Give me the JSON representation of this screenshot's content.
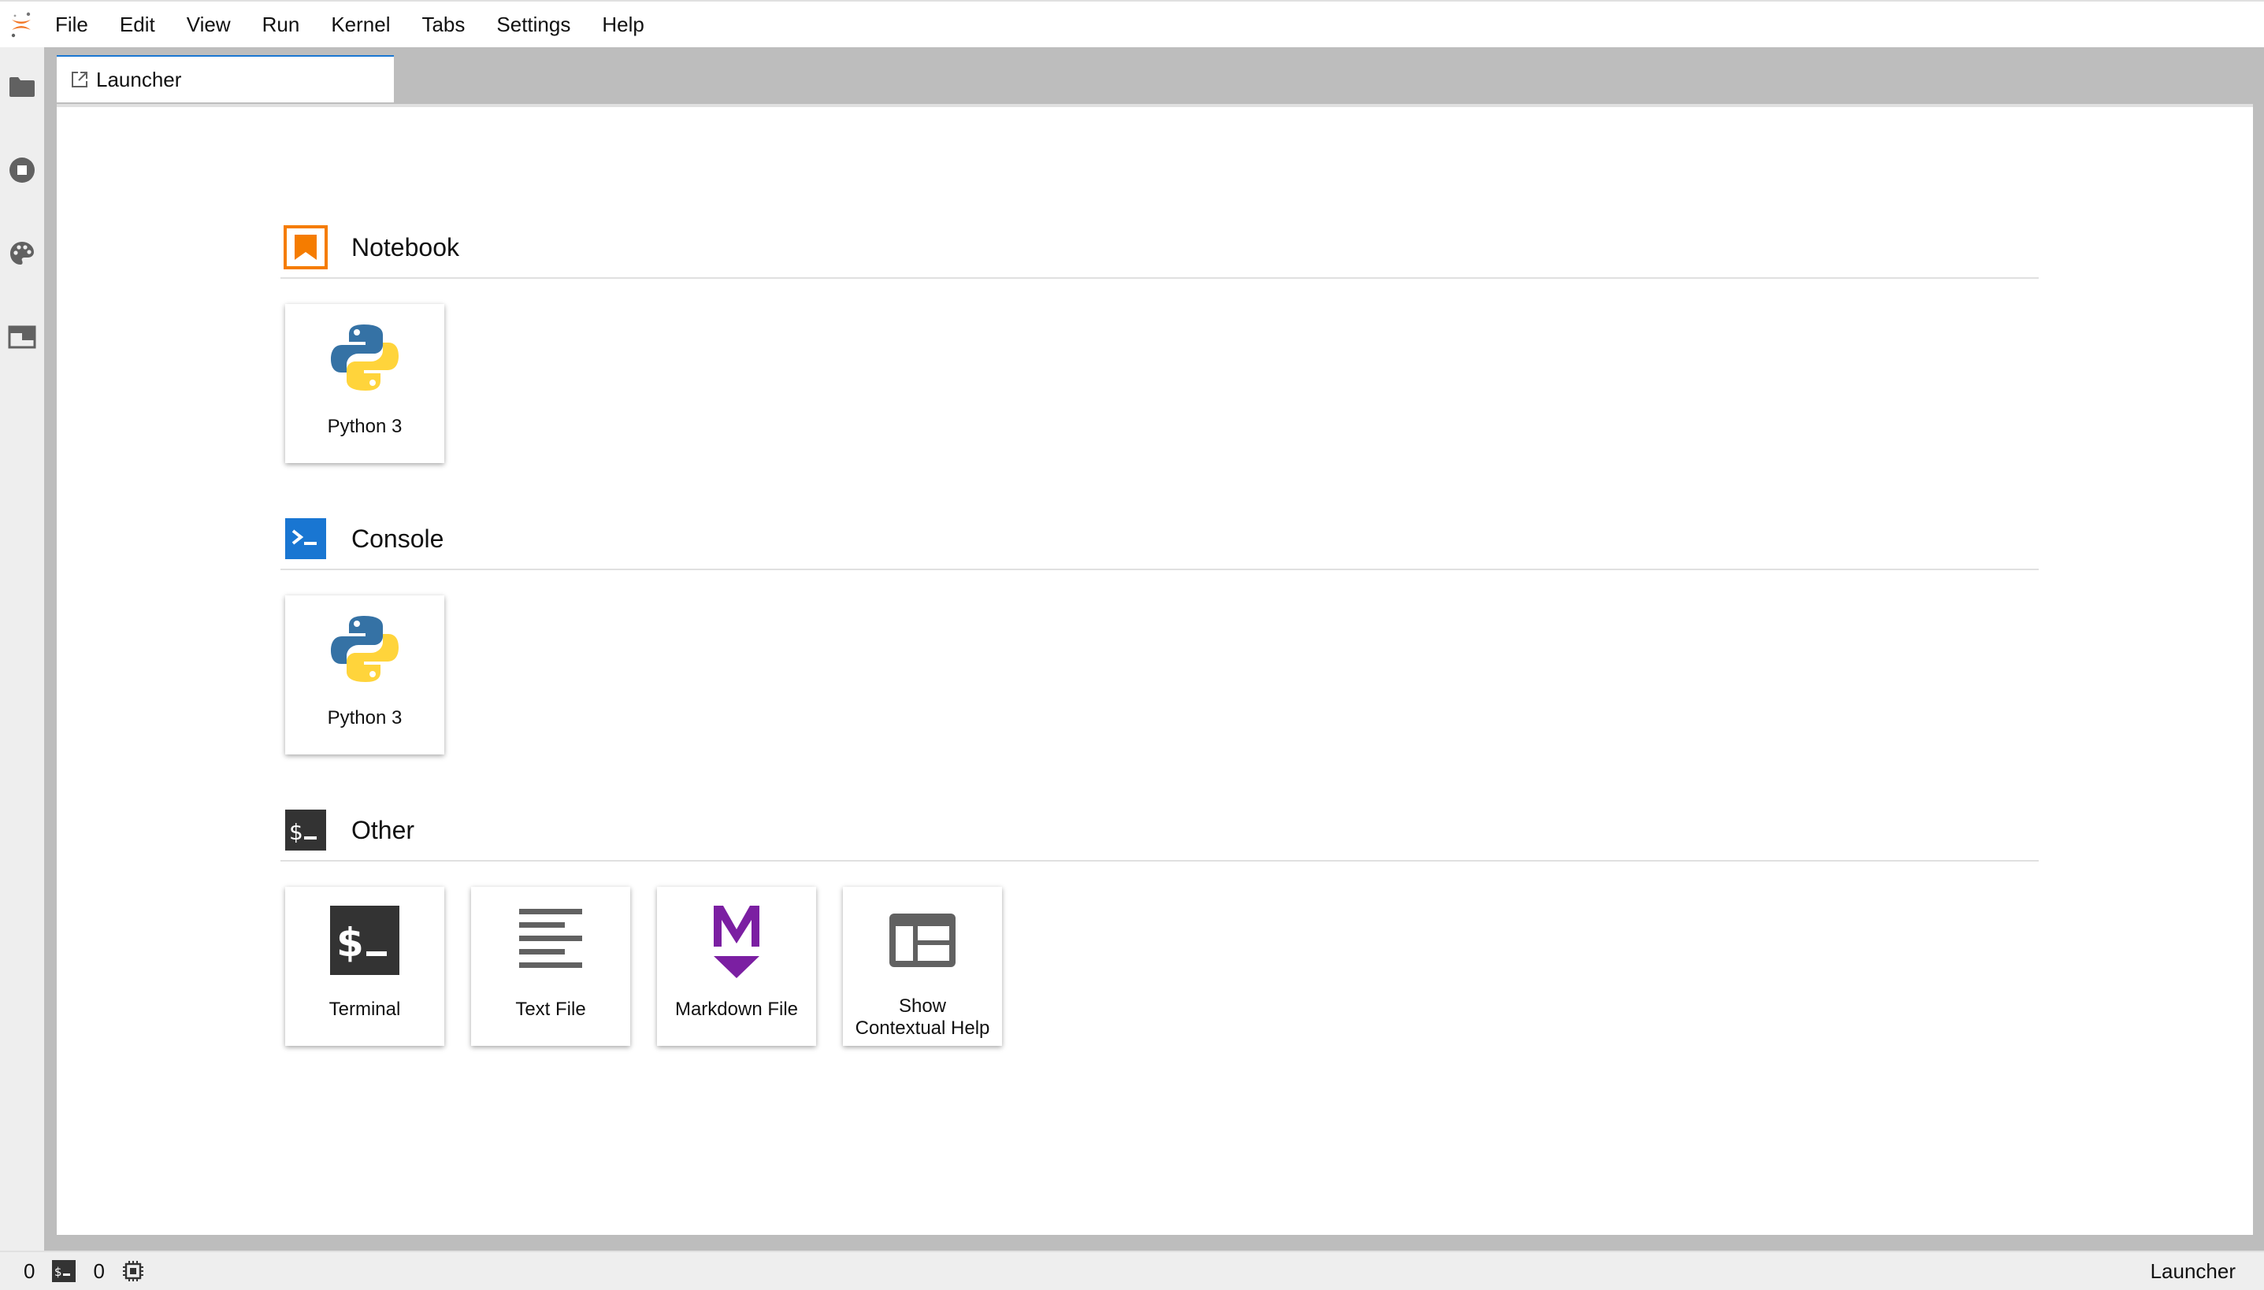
{
  "app": {
    "logo": "jupyter-logo"
  },
  "menu": [
    "File",
    "Edit",
    "View",
    "Run",
    "Kernel",
    "Tabs",
    "Settings",
    "Help"
  ],
  "sidebar": [
    {
      "icon": "folder-icon"
    },
    {
      "icon": "running-icon"
    },
    {
      "icon": "palette-icon"
    },
    {
      "icon": "tabs-icon"
    }
  ],
  "tabs": [
    {
      "label": "Launcher",
      "icon": "launcher-icon",
      "active": true
    }
  ],
  "launcher": {
    "sections": [
      {
        "title": "Notebook",
        "icon": "notebook-icon",
        "color": "#f57c00",
        "cards": [
          {
            "label": "Python 3",
            "icon": "python-icon"
          }
        ]
      },
      {
        "title": "Console",
        "icon": "console-icon",
        "color": "#1976d2",
        "cards": [
          {
            "label": "Python 3",
            "icon": "python-icon"
          }
        ]
      },
      {
        "title": "Other",
        "icon": "terminal-icon",
        "color": "#333333",
        "cards": [
          {
            "label": "Terminal",
            "icon": "terminal-icon"
          },
          {
            "label": "Text File",
            "icon": "text-file-icon"
          },
          {
            "label": "Markdown File",
            "icon": "markdown-icon",
            "color": "#7b1fa2"
          },
          {
            "label": "Show Contextual Help",
            "line1": "Show",
            "line2": "Contextual Help",
            "icon": "contextual-help-icon"
          }
        ]
      }
    ]
  },
  "status": {
    "kernels_count": "0",
    "terminals_count": "0",
    "right_label": "Launcher"
  }
}
